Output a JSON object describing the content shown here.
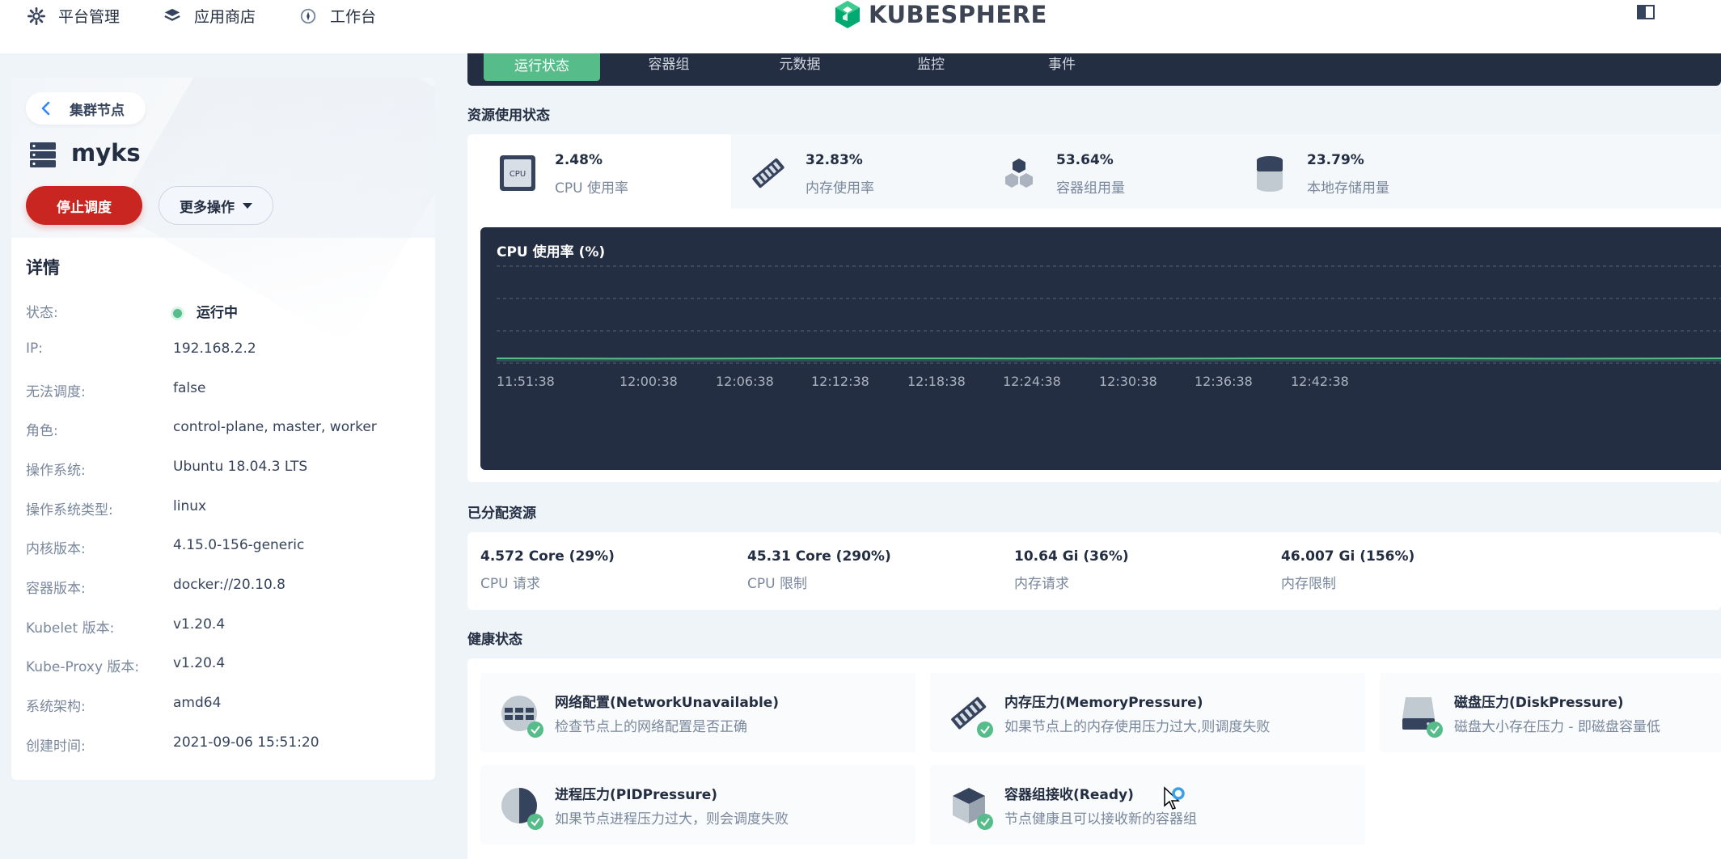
{
  "topnav": {
    "items": [
      {
        "label": "平台管理",
        "icon": "gear-icon"
      },
      {
        "label": "应用商店",
        "icon": "layers-icon"
      },
      {
        "label": "工作台",
        "icon": "compass-icon"
      }
    ],
    "logo_text": "KUBESPHERE"
  },
  "left": {
    "back_label": "集群节点",
    "node_name": "myks",
    "stop_label": "停止调度",
    "more_label": "更多操作",
    "details_title": "详情",
    "details": [
      {
        "label": "状态:",
        "value": "运行中"
      },
      {
        "label": "IP:",
        "value": "192.168.2.2"
      },
      {
        "label": "无法调度:",
        "value": "false"
      },
      {
        "label": "角色:",
        "value": "control-plane, master, worker"
      },
      {
        "label": "操作系统:",
        "value": "Ubuntu 18.04.3 LTS"
      },
      {
        "label": "操作系统类型:",
        "value": "linux"
      },
      {
        "label": "内核版本:",
        "value": "4.15.0-156-generic"
      },
      {
        "label": "容器版本:",
        "value": "docker://20.10.8"
      },
      {
        "label": "Kubelet 版本:",
        "value": "v1.20.4"
      },
      {
        "label": "Kube-Proxy 版本:",
        "value": "v1.20.4"
      },
      {
        "label": "系统架构:",
        "value": "amd64"
      },
      {
        "label": "创建时间:",
        "value": "2021-09-06 15:51:20"
      }
    ]
  },
  "tabs": [
    "运行状态",
    "容器组",
    "元数据",
    "监控",
    "事件"
  ],
  "usage": {
    "title": "资源使用状态",
    "items": [
      {
        "value": "2.48%",
        "label": "CPU 使用率",
        "icon": "cpu-icon"
      },
      {
        "value": "32.83%",
        "label": "内存使用率",
        "icon": "memory-icon"
      },
      {
        "value": "53.64%",
        "label": "容器组用量",
        "icon": "pods-icon"
      },
      {
        "value": "23.79%",
        "label": "本地存储用量",
        "icon": "storage-icon"
      }
    ]
  },
  "chart_data": {
    "type": "line",
    "title": "CPU 使用率 (%)",
    "x": [
      "11:51:38",
      "12:00:38",
      "12:06:38",
      "12:12:38",
      "12:18:38",
      "12:24:38",
      "12:30:38",
      "12:36:38",
      "12:42:38"
    ],
    "series": [
      {
        "values": [
          2.5,
          2.4,
          2.5,
          2.5,
          2.4,
          2.5,
          2.5,
          2.4,
          2.5
        ]
      }
    ],
    "ylim": [
      0,
      12
    ],
    "grid": true,
    "colors": {
      "line": "#55bc8a",
      "grid": "#5a6478",
      "background": "#242e42"
    }
  },
  "allocated": {
    "title": "已分配资源",
    "items": [
      {
        "value": "4.572 Core (29%)",
        "label": "CPU 请求"
      },
      {
        "value": "45.31 Core (290%)",
        "label": "CPU 限制"
      },
      {
        "value": "10.64 Gi (36%)",
        "label": "内存请求"
      },
      {
        "value": "46.007 Gi (156%)",
        "label": "内存限制"
      }
    ]
  },
  "health": {
    "title": "健康状态",
    "items": [
      {
        "title": "网络配置(NetworkUnavailable)",
        "desc": "检查节点上的网络配置是否正确",
        "icon": "network-icon"
      },
      {
        "title": "内存压力(MemoryPressure)",
        "desc": "如果节点上的内存使用压力过大,则调度失败",
        "icon": "memory-icon"
      },
      {
        "title": "磁盘压力(DiskPressure)",
        "desc": "磁盘大小存在压力 - 即磁盘容量低",
        "icon": "disk-icon"
      },
      {
        "title": "进程压力(PIDPressure)",
        "desc": "如果节点进程压力过大，则会调度失败",
        "icon": "pie-icon"
      },
      {
        "title": "容器组接收(Ready)",
        "desc": "节点健康且可以接收新的容器组",
        "icon": "cube-icon"
      }
    ]
  },
  "colors": {
    "accent": "#55bc8a",
    "danger": "#ca2621",
    "dark": "#242e42"
  }
}
